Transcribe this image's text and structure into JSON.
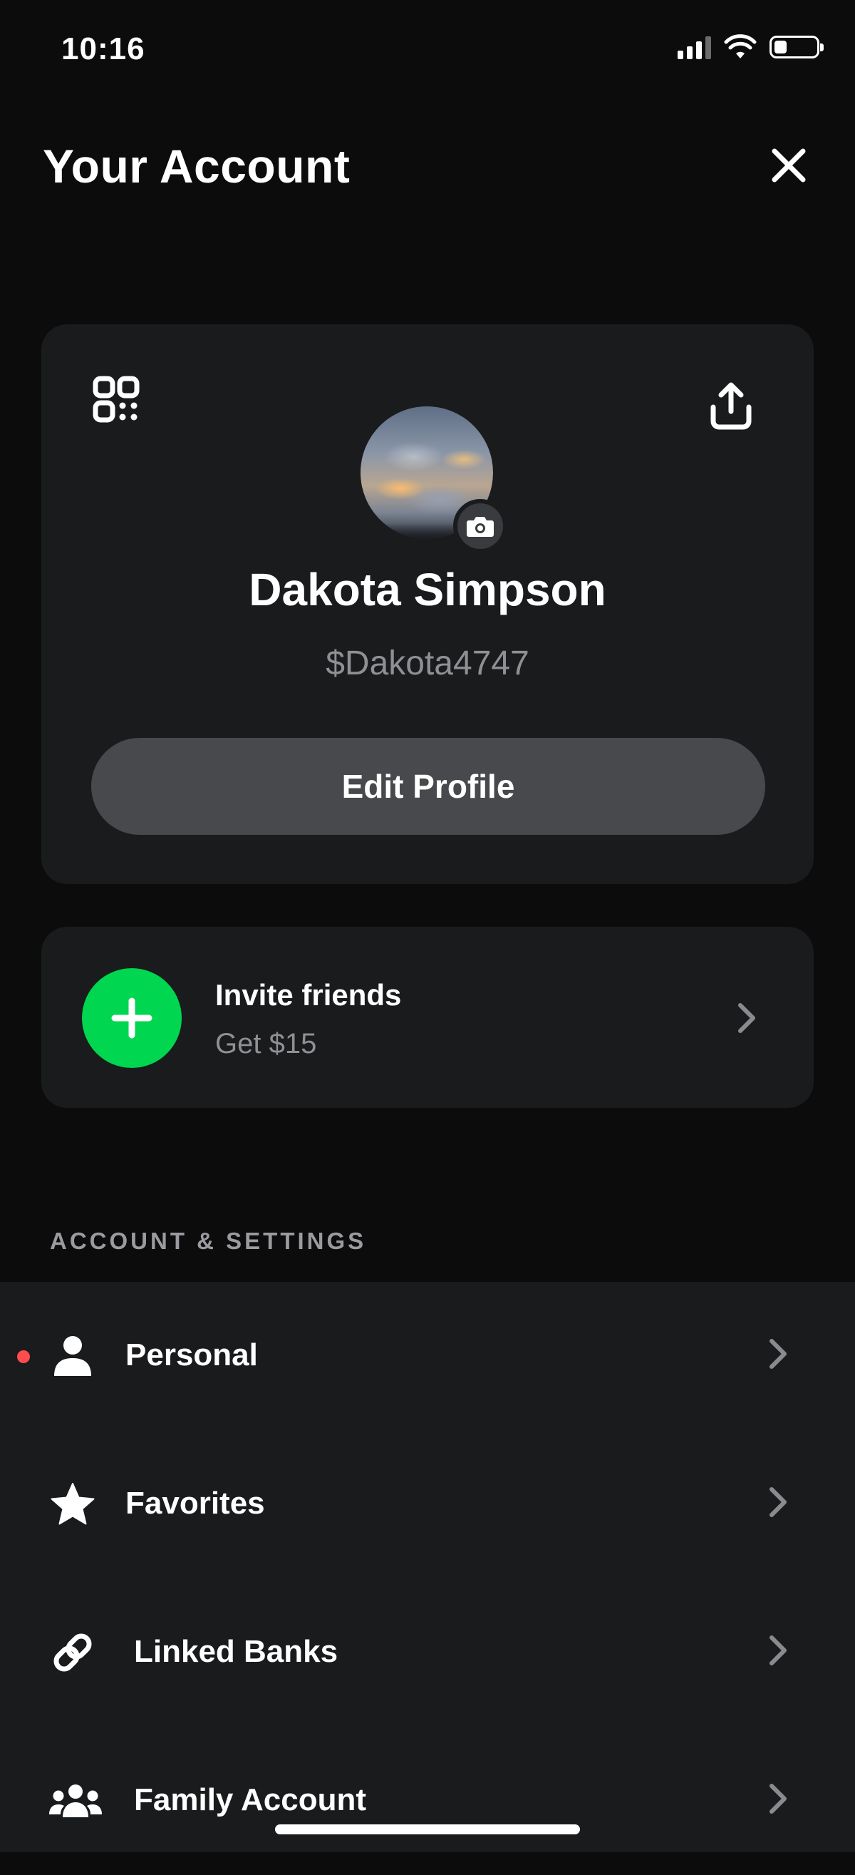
{
  "status_bar": {
    "time": "10:16",
    "battery_level": 0.3
  },
  "header": {
    "title": "Your Account"
  },
  "profile": {
    "name": "Dakota Simpson",
    "cashtag": "$Dakota4747",
    "edit_label": "Edit Profile"
  },
  "invite": {
    "title": "Invite friends",
    "subtitle": "Get $15",
    "accent_color": "#00d64f"
  },
  "settings": {
    "section_title": "ACCOUNT & SETTINGS",
    "items": [
      {
        "label": "Personal",
        "icon": "person-icon",
        "has_dot": true
      },
      {
        "label": "Favorites",
        "icon": "star-icon",
        "has_dot": false
      },
      {
        "label": "Linked Banks",
        "icon": "link-icon",
        "has_dot": false
      },
      {
        "label": "Family Account",
        "icon": "family-icon",
        "has_dot": false
      }
    ],
    "dot_color": "#ff4d4d"
  }
}
